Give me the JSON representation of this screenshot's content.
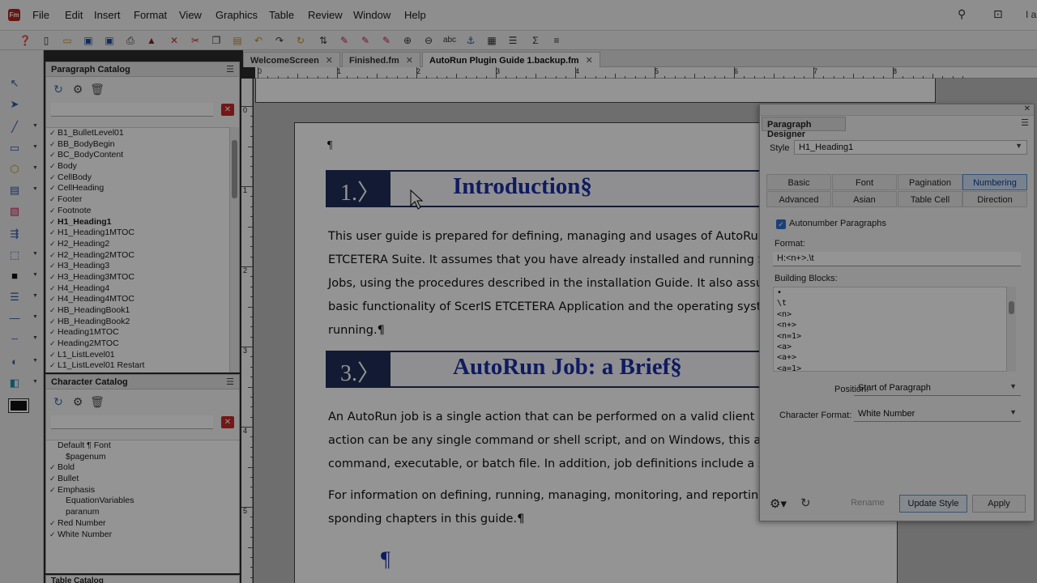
{
  "menubar": {
    "logo": "Fm",
    "items": [
      "File",
      "Edit",
      "Insert",
      "Format",
      "View",
      "Graphics",
      "Table",
      "Review",
      "Window",
      "Help"
    ],
    "right_text": "I a"
  },
  "tabs": [
    {
      "label": "WelcomeScreen",
      "close": "✕"
    },
    {
      "label": "Finished.fm",
      "close": "✕"
    },
    {
      "label": "AutoRun Plugin Guide 1.backup.fm",
      "close": "✕"
    }
  ],
  "ruler": {
    "h": [
      "0",
      "1",
      "2",
      "3",
      "4",
      "5",
      "6",
      "7",
      "8"
    ],
    "v": [
      "0",
      "1",
      "2",
      "3",
      "4",
      "5"
    ]
  },
  "paragraph_catalog": {
    "title": "Paragraph Catalog",
    "menu": "☰",
    "items": [
      {
        "label": "B1_BulletLevel01",
        "checked": true
      },
      {
        "label": "BB_BodyBegin",
        "checked": true
      },
      {
        "label": "BC_BodyContent",
        "checked": true
      },
      {
        "label": "Body",
        "checked": true
      },
      {
        "label": "CellBody",
        "checked": true
      },
      {
        "label": "CellHeading",
        "checked": true
      },
      {
        "label": "Footer",
        "checked": true
      },
      {
        "label": "Footnote",
        "checked": true
      },
      {
        "label": "H1_Heading1",
        "checked": true,
        "bold": true
      },
      {
        "label": "H1_Heading1MTOC",
        "checked": true
      },
      {
        "label": "H2_Heading2",
        "checked": true
      },
      {
        "label": "H2_Heading2MTOC",
        "checked": true
      },
      {
        "label": "H3_Heading3",
        "checked": true
      },
      {
        "label": "H3_Heading3MTOC",
        "checked": true
      },
      {
        "label": "H4_Heading4",
        "checked": true
      },
      {
        "label": "H4_Heading4MTOC",
        "checked": true
      },
      {
        "label": "HB_HeadingBook1",
        "checked": true
      },
      {
        "label": "HB_HeadingBook2",
        "checked": true
      },
      {
        "label": "Heading1MTOC",
        "checked": true
      },
      {
        "label": "Heading2MTOC",
        "checked": true
      },
      {
        "label": "L1_ListLevel01",
        "checked": true
      },
      {
        "label": "L1_ListLevel01 Restart",
        "checked": true
      }
    ]
  },
  "character_catalog": {
    "title": "Character Catalog",
    "menu": "☰",
    "items": [
      {
        "label": "Default ¶ Font",
        "checked": false
      },
      {
        "label": "$pagenum",
        "checked": false
      },
      {
        "label": "Bold",
        "checked": true
      },
      {
        "label": "Bullet",
        "checked": true
      },
      {
        "label": "Emphasis",
        "checked": true
      },
      {
        "label": "EquationVariables",
        "checked": false
      },
      {
        "label": "paranum",
        "checked": false
      },
      {
        "label": "Red Number",
        "checked": true
      },
      {
        "label": "White Number",
        "checked": true
      }
    ]
  },
  "table_catalog_title": "Table Catalog",
  "document": {
    "heading1": {
      "number": "1.〉",
      "text": "Introduction§"
    },
    "para1": [
      "This user guide is prepared for defining, managing and usages of AutoRun job",
      "ETCETERA Suite. It assumes that you have already installed and running ScerIS",
      "Jobs, using the procedures described in the installation Guide. It also assumes",
      "basic functionality of ScerIS ETCETERA Application and the operating system or",
      "running.¶"
    ],
    "heading2": {
      "number": "3.〉",
      "text": "AutoRun Job: a Brief§"
    },
    "para2": [
      "An AutoRun job is a single action that can be performed on a valid client mac",
      "action can be any single command or shell script, and on Windows, this actio",
      "command, executable, or batch file. In addition, job definitions include a set of q"
    ],
    "para3": [
      "For information on defining, running, managing, monitoring, and reporting on",
      "sponding chapters in this guide.¶"
    ],
    "end_mark": "¶",
    "top_mark": "¶"
  },
  "designer": {
    "title": "Paragraph Designer",
    "close": "✕",
    "style_label": "Style",
    "style_value": "H1_Heading1",
    "tabs_row1": [
      "Basic",
      "Font",
      "Pagination",
      "Numbering"
    ],
    "tabs_row2": [
      "Advanced",
      "Asian",
      "Table Cell",
      "Direction"
    ],
    "active_tab": "Numbering",
    "autonumber_label": "Autonumber Paragraphs",
    "format_label": "Format:",
    "format_value": "H:<n+>.\\t",
    "blocks_label": "Building Blocks:",
    "blocks": [
      "•",
      "\\t",
      "<n>",
      "<n+>",
      "<n=1>",
      "<a>",
      "<a+>",
      "<a=1>"
    ],
    "position_label": "Position:",
    "position_value": "Start of Paragraph",
    "charformat_label": "Character Format:",
    "charformat_value": "White Number",
    "btn_rename": "Rename",
    "btn_update": "Update Style",
    "btn_apply": "Apply"
  }
}
